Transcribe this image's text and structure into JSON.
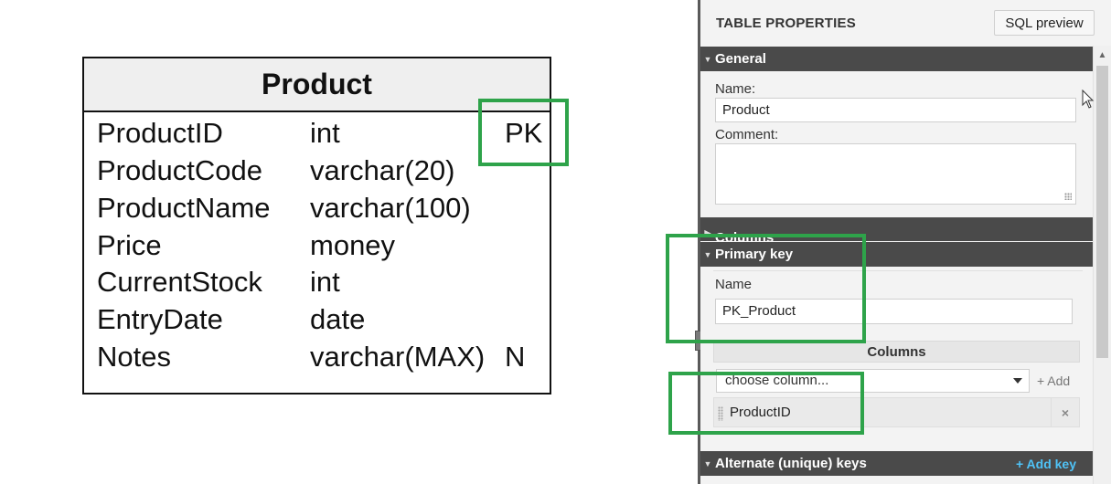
{
  "diagram": {
    "entity_title": "Product",
    "columns": [
      {
        "name": "ProductID",
        "type": "int",
        "flag": "PK"
      },
      {
        "name": "ProductCode",
        "type": "varchar(20)",
        "flag": ""
      },
      {
        "name": "ProductName",
        "type": "varchar(100)",
        "flag": ""
      },
      {
        "name": "Price",
        "type": "money",
        "flag": ""
      },
      {
        "name": "CurrentStock",
        "type": "int",
        "flag": ""
      },
      {
        "name": "EntryDate",
        "type": "date",
        "flag": ""
      },
      {
        "name": "Notes",
        "type": "varchar(MAX)",
        "flag": "N"
      }
    ]
  },
  "panel": {
    "title": "TABLE PROPERTIES",
    "sql_preview_label": "SQL preview",
    "sections": {
      "general": "General",
      "columns": "Columns",
      "primary_key": "Primary key",
      "alternate_keys": "Alternate (unique) keys",
      "add_key_label": "+ Add key"
    },
    "general": {
      "name_label": "Name:",
      "name_value": "Product",
      "comment_label": "Comment:",
      "comment_value": ""
    },
    "primary_key": {
      "name_label": "Name",
      "name_value": "PK_Product",
      "columns_header": "Columns",
      "choose_placeholder": "choose column...",
      "add_label": "+ Add",
      "selected_columns": [
        "ProductID"
      ],
      "remove_icon": "×"
    }
  },
  "colors": {
    "highlight": "#2ea34a",
    "section_bar": "#4a4a4a",
    "link_accent": "#4fc3f7"
  }
}
